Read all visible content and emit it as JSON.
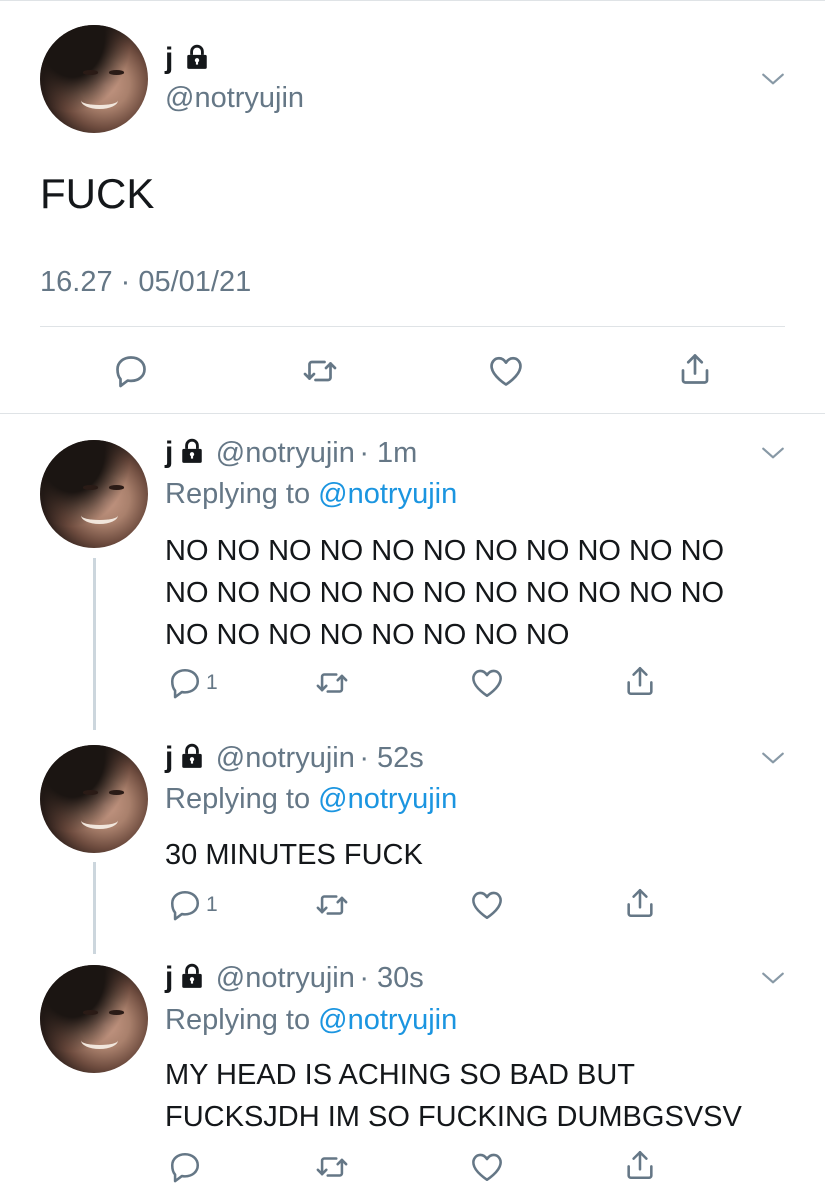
{
  "main_tweet": {
    "name": "j",
    "handle": "@notryujin",
    "text": "FUCK",
    "timestamp": "16.27 · 05/01/21"
  },
  "replies": [
    {
      "name": "j",
      "handle": "@notryujin",
      "time": "· 1m",
      "replying_label": "Replying to",
      "replying_handle": "@notryujin",
      "lines": [
        "NO NO NO NO NO NO NO NO NO NO NO",
        "NO NO NO NO NO NO NO NO NO NO NO",
        "NO NO NO NO NO NO NO NO"
      ],
      "reply_count": "1"
    },
    {
      "name": "j",
      "handle": "@notryujin",
      "time": "· 52s",
      "replying_label": "Replying to",
      "replying_handle": "@notryujin",
      "lines": [
        "30 MINUTES FUCK"
      ],
      "reply_count": "1"
    },
    {
      "name": "j",
      "handle": "@notryujin",
      "time": "· 30s",
      "replying_label": "Replying to",
      "replying_handle": "@notryujin",
      "lines": [
        "MY HEAD IS ACHING SO BAD BUT",
        "FUCKSJDH IM SO FUCKING DUMBGSVSV"
      ],
      "reply_count": ""
    }
  ],
  "icons": {
    "lock": "lock-icon",
    "chevron": "chevron-down-icon",
    "reply": "reply-icon",
    "retweet": "retweet-icon",
    "like": "heart-icon",
    "share": "share-icon"
  },
  "colors": {
    "link": "#1b95e0",
    "secondary_text": "#657786",
    "divider": "#dfe3e6"
  }
}
